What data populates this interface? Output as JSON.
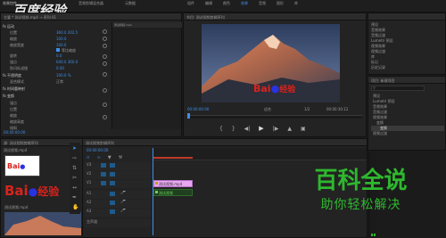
{
  "topbar": {
    "tabs": [
      "效果控件",
      "音频剪辑混合器",
      "元数据"
    ],
    "workspaces": [
      "组件",
      "编辑",
      "颜色",
      "效果",
      "音频",
      "图形",
      "库"
    ],
    "active_workspace": "效果"
  },
  "watermark_tl": "百度经验",
  "effect_controls": {
    "header": "主要 * 测试视频.mp4 → 序列 01",
    "sections": [
      {
        "label": "fx 运动",
        "items": [
          "位置",
          "缩放",
          "缩放宽度"
        ]
      },
      {
        "label": "",
        "items": [
          "旋转",
          "锚点",
          "防闪烁滤镜"
        ]
      },
      {
        "label": "fx 不透明度",
        "items": [
          "混合模式"
        ]
      },
      {
        "label": "fx 时间重映射",
        "items": []
      },
      {
        "label": "fx 变换",
        "items": [
          "锚点",
          "位置",
          "缩放",
          "缩放高度",
          "倾斜"
        ]
      }
    ],
    "values": [
      "360.0  202.5",
      "100.0",
      "100.0",
      "0.0",
      "640.0  360.0",
      "0.00",
      "100.0 %",
      "正常"
    ],
    "checkbox_label": "等比缩放",
    "timecode": "00:00:00:00"
  },
  "program": {
    "header": "节目: 测试视频剪辑序列",
    "timecode_left": "00:00:00:00",
    "fit_label": "适合",
    "page": "1/2",
    "timecode_right": "00:00:30:12",
    "overlay_text": "Bai",
    "overlay_text2": "经验"
  },
  "effects_panel": {
    "items": [
      "预设",
      "音频效果",
      "音频过渡",
      "Lumetri 预设",
      "视频效果",
      "视频过渡",
      "库",
      "标记",
      "历史记录",
      "信息"
    ]
  },
  "project_panel": {
    "header": "项目: 新建项目",
    "search_placeholder": "",
    "tree": [
      "预设",
      "Lumetri 预设",
      "音频效果",
      "音频过渡",
      "视频效果",
      "变换",
      "变换",
      "视频过渡"
    ],
    "selected_index": 6
  },
  "source_panel": {
    "header": "源: 测试视频剪辑序列",
    "sub": "测试视频.mp4",
    "file_label": "测试视频.mp4",
    "logo_left": "Bai",
    "logo_right": "经验"
  },
  "timeline": {
    "header": "测试视频剪辑序列",
    "timecode": "00:00:00:00",
    "tracks": [
      "V3",
      "V2",
      "V1",
      "A1",
      "A2",
      "A3",
      "主声道"
    ],
    "clips": [
      {
        "label": "测试视频.mp4",
        "color": "#e8a7f2"
      },
      {
        "label": "测试视频",
        "color": "#6ecf5c"
      }
    ]
  },
  "watermark_br": {
    "title": "百科全说",
    "subtitle": "助你轻松解决"
  },
  "colors": {
    "accent": "#3d8fe8",
    "brand_green": "#2eb82e",
    "baidu_red": "#d9231c",
    "baidu_blue": "#2932e1"
  }
}
